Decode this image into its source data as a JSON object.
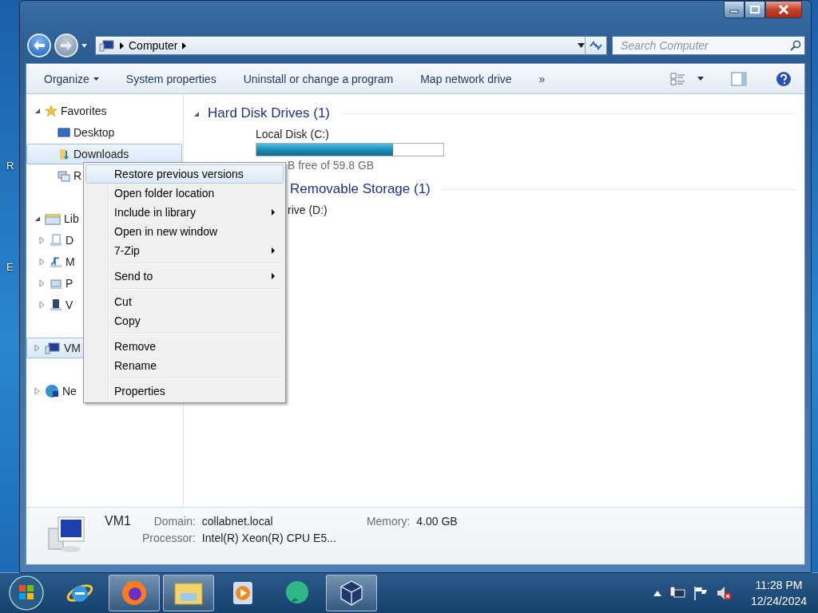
{
  "desktop": {
    "icon_labels": [
      "R",
      "E"
    ]
  },
  "window": {
    "address": {
      "crumbs": [
        "Computer"
      ]
    },
    "search": {
      "placeholder": "Search Computer"
    },
    "toolbar": {
      "buttons": [
        {
          "label": "Organize",
          "dropdown": true
        },
        {
          "label": "System properties",
          "dropdown": false
        },
        {
          "label": "Uninstall or change a program",
          "dropdown": false
        },
        {
          "label": "Map network drive",
          "dropdown": false
        }
      ],
      "more": "»"
    },
    "nav": [
      {
        "label": "Favorites",
        "kind": "star",
        "expanded": true,
        "selected": false,
        "children": [
          {
            "label": "Desktop",
            "kind": "desktop",
            "selected": false
          },
          {
            "label": "Downloads",
            "kind": "downloads",
            "selected": true
          },
          {
            "label": "R",
            "kind": "recent",
            "selected": false
          }
        ]
      },
      {
        "label": "Lib",
        "kind": "libraries",
        "expanded": true,
        "selected": false,
        "children": [
          {
            "label": "D",
            "kind": "documents",
            "expanded": false,
            "selected": false
          },
          {
            "label": "M",
            "kind": "music",
            "expanded": false,
            "selected": false
          },
          {
            "label": "P",
            "kind": "pictures",
            "expanded": false,
            "selected": false
          },
          {
            "label": "V",
            "kind": "videos",
            "expanded": false,
            "selected": false
          }
        ]
      },
      {
        "label": "VM",
        "kind": "computer",
        "expanded": false,
        "selected": true
      },
      {
        "label": "Ne",
        "kind": "network",
        "expanded": false,
        "selected": false
      }
    ],
    "groups": [
      {
        "title": "Hard Disk Drives (1)",
        "expanded": true,
        "items": [
          {
            "name": "Local Disk (C:)",
            "level": 0.73,
            "free": "B free of 59.8 GB"
          }
        ]
      },
      {
        "title": "Removable Storage (1)",
        "items": [
          {
            "name": "rive (D:)"
          }
        ]
      }
    ],
    "details": {
      "name": "VM1",
      "fields": [
        {
          "label": "Domain:",
          "value": "collabnet.local"
        },
        {
          "label": "Memory:",
          "value": "4.00 GB"
        },
        {
          "label": "Processor:",
          "value": "Intel(R) Xeon(R) CPU E5..."
        }
      ]
    }
  },
  "context_menu": [
    {
      "kind": "item",
      "label": "Restore previous versions",
      "submenu": false,
      "selected": true
    },
    {
      "kind": "item",
      "label": "Open folder location",
      "submenu": false,
      "selected": false
    },
    {
      "kind": "item",
      "label": "Include in library",
      "submenu": true,
      "selected": false
    },
    {
      "kind": "item",
      "label": "Open in new window",
      "submenu": false,
      "selected": false
    },
    {
      "kind": "item",
      "label": "7-Zip",
      "submenu": true,
      "selected": false
    },
    {
      "kind": "separator"
    },
    {
      "kind": "item",
      "label": "Send to",
      "submenu": true,
      "selected": false
    },
    {
      "kind": "separator"
    },
    {
      "kind": "item",
      "label": "Cut",
      "submenu": false,
      "selected": false
    },
    {
      "kind": "item",
      "label": "Copy",
      "submenu": false,
      "selected": false
    },
    {
      "kind": "separator"
    },
    {
      "kind": "item",
      "label": "Remove",
      "submenu": false,
      "selected": false
    },
    {
      "kind": "item",
      "label": "Rename",
      "submenu": false,
      "selected": false
    },
    {
      "kind": "separator"
    },
    {
      "kind": "item",
      "label": "Properties",
      "submenu": false,
      "selected": false
    }
  ],
  "taskbar": {
    "apps": [
      {
        "kind": "ie",
        "active": false
      },
      {
        "kind": "firefox",
        "active": true
      },
      {
        "kind": "explorer",
        "active": true
      },
      {
        "kind": "media",
        "active": false
      },
      {
        "kind": "chat",
        "active": false
      },
      {
        "kind": "virtualbox",
        "active": true
      }
    ],
    "clock": {
      "time": "11:28 PM",
      "date": "12/24/2024"
    }
  }
}
